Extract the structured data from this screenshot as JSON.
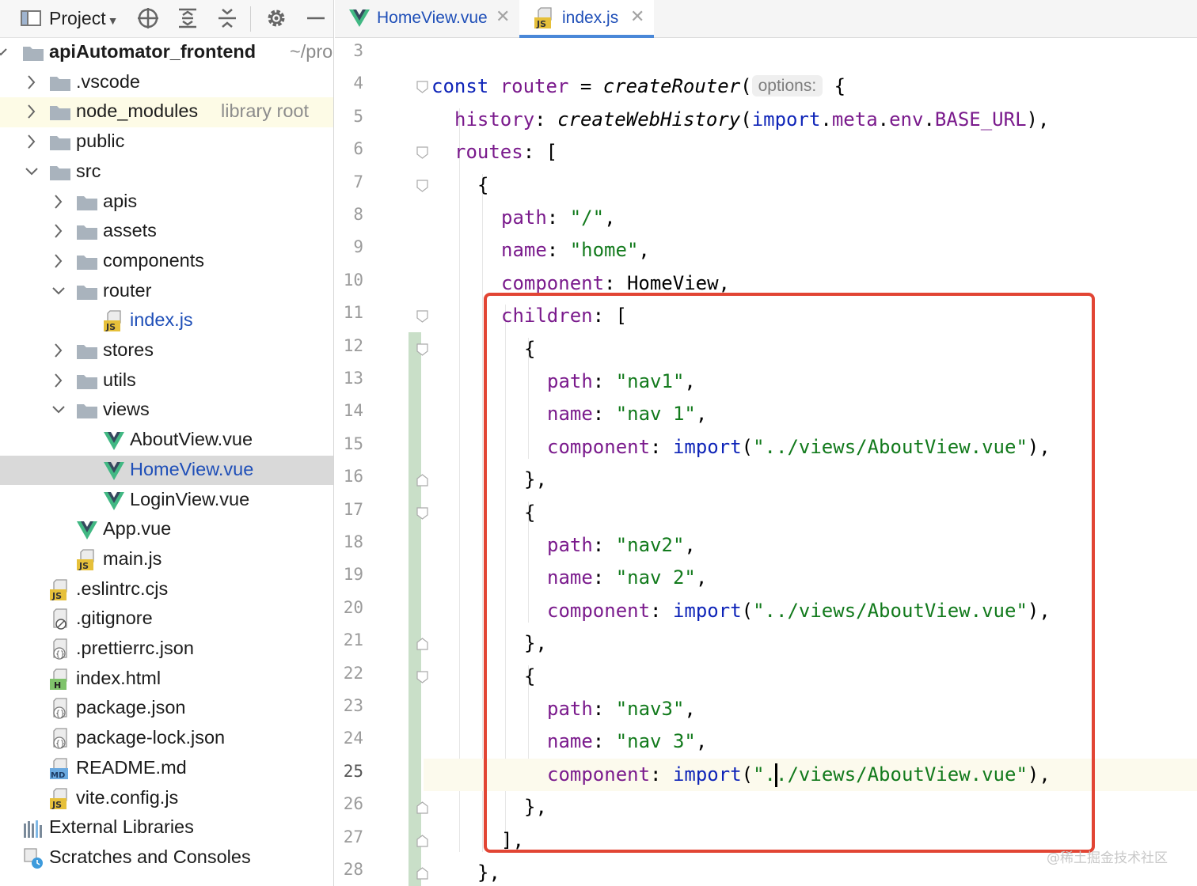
{
  "project_panel": {
    "title": "Project",
    "toolbar_icons": [
      "locate-icon",
      "expand-all-icon",
      "collapse-all-icon",
      "gear-icon",
      "minimize-icon"
    ],
    "tree": [
      {
        "label": "apiAutomator_frontend",
        "hint": "~/pro",
        "type": "root-folder",
        "expanded": true
      },
      {
        "label": ".vscode",
        "type": "folder"
      },
      {
        "label": "node_modules",
        "hint": "library root",
        "type": "folder"
      },
      {
        "label": "public",
        "type": "folder"
      },
      {
        "label": "src",
        "type": "folder",
        "expanded": true
      },
      {
        "label": "apis",
        "type": "folder"
      },
      {
        "label": "assets",
        "type": "folder"
      },
      {
        "label": "components",
        "type": "folder"
      },
      {
        "label": "router",
        "type": "folder",
        "expanded": true
      },
      {
        "label": "index.js",
        "type": "js"
      },
      {
        "label": "stores",
        "type": "folder"
      },
      {
        "label": "utils",
        "type": "folder"
      },
      {
        "label": "views",
        "type": "folder",
        "expanded": true
      },
      {
        "label": "AboutView.vue",
        "type": "vue"
      },
      {
        "label": "HomeView.vue",
        "type": "vue",
        "selected": true
      },
      {
        "label": "LoginView.vue",
        "type": "vue"
      },
      {
        "label": "App.vue",
        "type": "vue"
      },
      {
        "label": "main.js",
        "type": "js"
      },
      {
        "label": ".eslintrc.cjs",
        "type": "js"
      },
      {
        "label": ".gitignore",
        "type": "ignore"
      },
      {
        "label": ".prettierrc.json",
        "type": "json"
      },
      {
        "label": "index.html",
        "type": "html"
      },
      {
        "label": "package.json",
        "type": "json"
      },
      {
        "label": "package-lock.json",
        "type": "json"
      },
      {
        "label": "README.md",
        "type": "md"
      },
      {
        "label": "vite.config.js",
        "type": "js"
      },
      {
        "label": "External Libraries",
        "type": "libraries"
      },
      {
        "label": "Scratches and Consoles",
        "type": "scratches"
      }
    ]
  },
  "editor": {
    "tabs": [
      {
        "label": "HomeView.vue",
        "icon": "vue-icon",
        "close": "✕"
      },
      {
        "label": "index.js",
        "icon": "js-file-icon",
        "close": "✕",
        "active": true
      }
    ],
    "line_numbers": [
      "3",
      "4",
      "5",
      "6",
      "7",
      "8",
      "9",
      "10",
      "11",
      "12",
      "13",
      "14",
      "15",
      "16",
      "17",
      "18",
      "19",
      "20",
      "21",
      "22",
      "23",
      "24",
      "25",
      "26",
      "27",
      "28"
    ],
    "current_line": "25",
    "inlay_hint": "options:",
    "code": {
      "l4": {
        "k1": "const",
        "v": "router",
        "op": " = ",
        "fn": "createRouter",
        "p": "(",
        "tail": "{"
      },
      "l5": {
        "prop": "history",
        "c": ": ",
        "fn": "createWebHistory",
        "p1": "(",
        "kw": "import",
        "d1": ".",
        "m": "meta",
        "d2": ".",
        "e": "env",
        "d3": ".",
        "b": "BASE_URL",
        "p2": "),"
      },
      "l6": {
        "prop": "routes",
        "c": ": ["
      },
      "l7": {
        "p": "{"
      },
      "l8": {
        "prop": "path",
        "c": ": ",
        "s": "\"/\"",
        "e": ","
      },
      "l9": {
        "prop": "name",
        "c": ": ",
        "s": "\"home\"",
        "e": ","
      },
      "l10": {
        "prop": "component",
        "c": ": ",
        "v": "HomeView",
        "e": ","
      },
      "l11": {
        "prop": "children",
        "c": ": ["
      },
      "l12": {
        "p": "{"
      },
      "l13": {
        "prop": "path",
        "c": ": ",
        "s": "\"nav1\"",
        "e": ","
      },
      "l14": {
        "prop": "name",
        "c": ": ",
        "s": "\"nav 1\"",
        "e": ","
      },
      "l15": {
        "prop": "component",
        "c": ": ",
        "kw": "import",
        "p1": "(",
        "s": "\"../views/AboutView.vue\"",
        "p2": "),"
      },
      "l16": {
        "p": "},"
      },
      "l17": {
        "p": "{"
      },
      "l18": {
        "prop": "path",
        "c": ": ",
        "s": "\"nav2\"",
        "e": ","
      },
      "l19": {
        "prop": "name",
        "c": ": ",
        "s": "\"nav 2\"",
        "e": ","
      },
      "l20": {
        "prop": "component",
        "c": ": ",
        "kw": "import",
        "p1": "(",
        "s": "\"../views/AboutView.vue\"",
        "p2": "),"
      },
      "l21": {
        "p": "},"
      },
      "l22": {
        "p": "{"
      },
      "l23": {
        "prop": "path",
        "c": ": ",
        "s": "\"nav3\"",
        "e": ","
      },
      "l24": {
        "prop": "name",
        "c": ": ",
        "s": "\"nav 3\"",
        "e": ","
      },
      "l25": {
        "prop": "component",
        "c": ": ",
        "kw": "import",
        "p1": "(",
        "s_a": "\".",
        "s_b": "./views/AboutView.vue\"",
        "p2": "),"
      },
      "l26": {
        "p": "},"
      },
      "l27": {
        "p": "],"
      },
      "l28": {
        "p": "},"
      }
    }
  },
  "watermark": "@稀土掘金技术社区",
  "colors": {
    "keyword": "#0e24b8",
    "property": "#7a1a8c",
    "string": "#127a1c",
    "annotation_box": "#e24534",
    "vue_green": "#41b883",
    "vue_dark": "#35495e",
    "selection": "#d9d9d9"
  }
}
